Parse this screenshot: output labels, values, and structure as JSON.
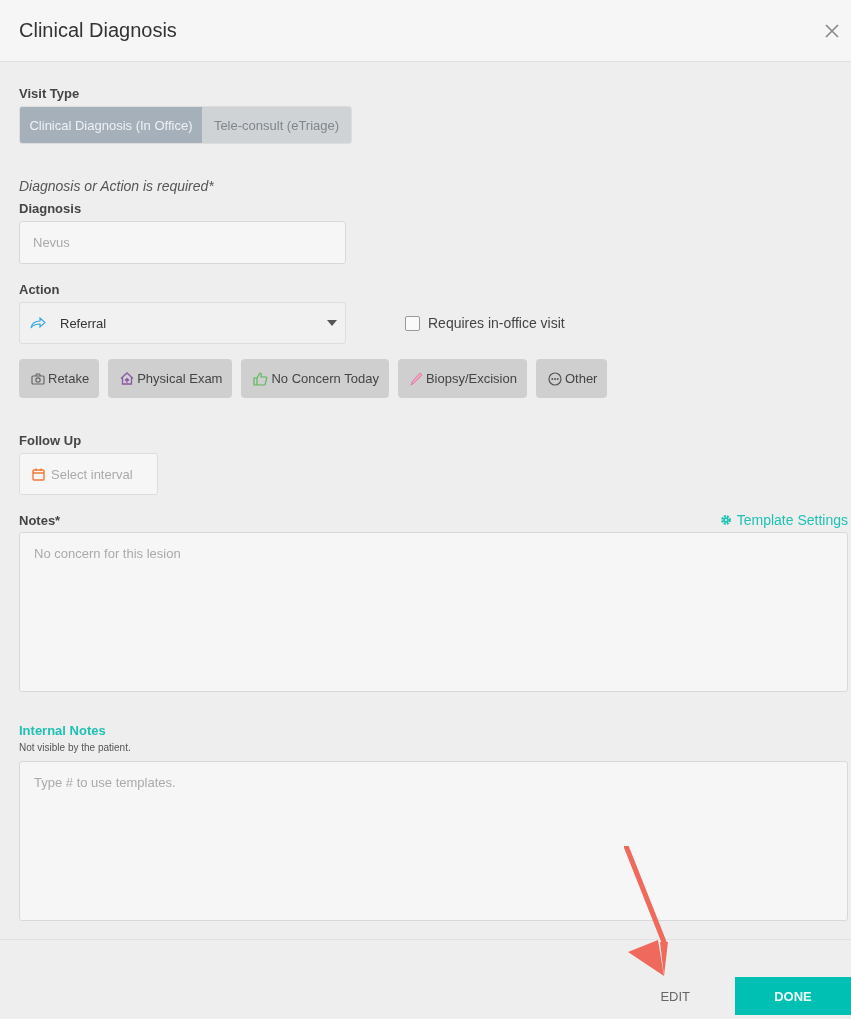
{
  "dialog": {
    "title": "Clinical Diagnosis"
  },
  "visit_type": {
    "label": "Visit Type",
    "options": [
      {
        "label": "Clinical Diagnosis (In Office)",
        "selected": true
      },
      {
        "label": "Tele-consult (eTriage)",
        "selected": false
      }
    ]
  },
  "required_note": "Diagnosis or Action is required*",
  "diagnosis": {
    "label": "Diagnosis",
    "placeholder": "Nevus"
  },
  "action": {
    "label": "Action",
    "value": "Referral"
  },
  "requires_visit": {
    "label": "Requires in-office visit",
    "checked": false
  },
  "quick_actions": [
    {
      "kind": "camera",
      "label": "Retake"
    },
    {
      "kind": "house",
      "label": "Physical Exam"
    },
    {
      "kind": "thumb",
      "label": "No Concern Today"
    },
    {
      "kind": "pen",
      "label": "Biopsy/Excision"
    },
    {
      "kind": "dots",
      "label": "Other"
    }
  ],
  "follow_up": {
    "label": "Follow Up",
    "placeholder": "Select interval"
  },
  "notes": {
    "label": "Notes*",
    "link": "Template Settings",
    "placeholder": "No concern for this lesion"
  },
  "internal_notes": {
    "label": "Internal Notes",
    "hint": "Not visible by the patient.",
    "placeholder": "Type # to use templates."
  },
  "footer": {
    "buttons": [
      {
        "kind": "text",
        "label": "EDIT"
      },
      {
        "kind": "primary",
        "label": "DONE"
      }
    ]
  }
}
